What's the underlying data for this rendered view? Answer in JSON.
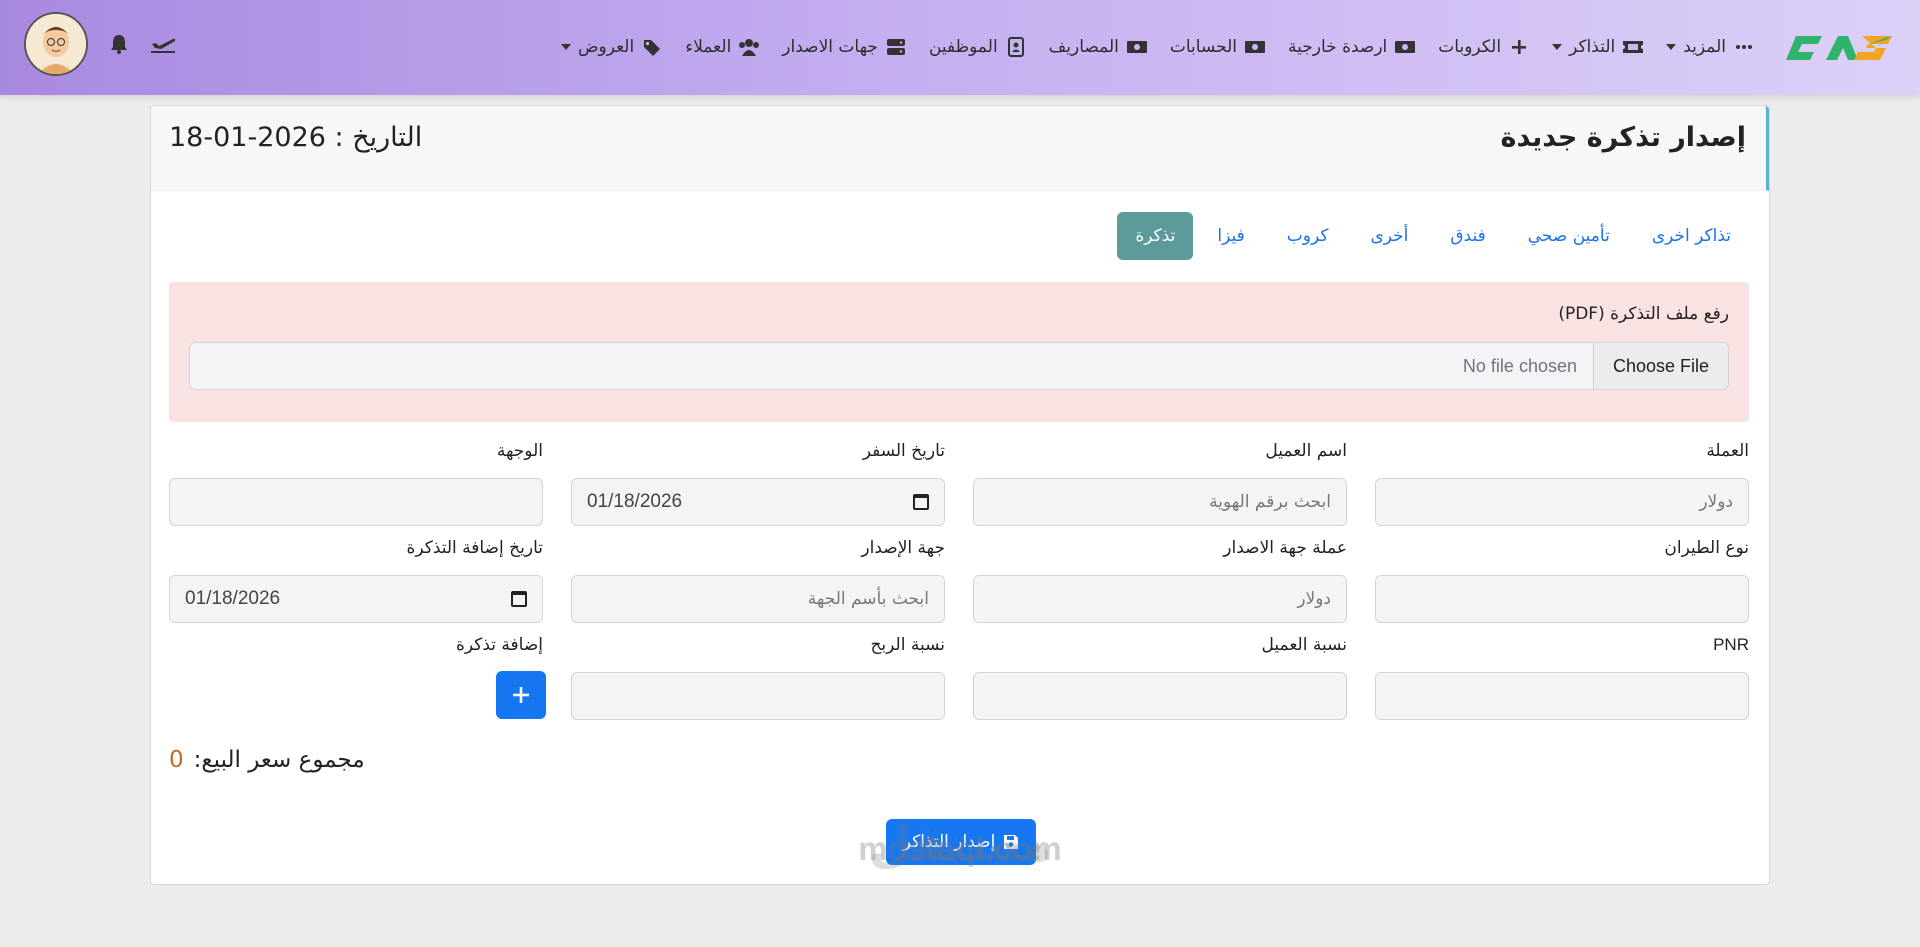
{
  "nav": {
    "items": [
      {
        "label": "العروض",
        "icon": "tags-icon",
        "dropdown": true
      },
      {
        "label": "العملاء",
        "icon": "users-icon",
        "dropdown": false
      },
      {
        "label": "جهات الاصدار",
        "icon": "server-icon",
        "dropdown": false
      },
      {
        "label": "الموظفين",
        "icon": "id-card-icon",
        "dropdown": false
      },
      {
        "label": "المصاريف",
        "icon": "money-icon",
        "dropdown": false
      },
      {
        "label": "الحسابات",
        "icon": "money-icon",
        "dropdown": false
      },
      {
        "label": "ارصدة خارجية",
        "icon": "money-icon",
        "dropdown": false
      },
      {
        "label": "الكروبات",
        "icon": "plus-icon",
        "dropdown": false
      },
      {
        "label": "التذاكر",
        "icon": "ticket-icon",
        "dropdown": true
      },
      {
        "label": "المزيد",
        "icon": "ellipsis-icon",
        "dropdown": true
      }
    ]
  },
  "card": {
    "title": "إصدار تذكرة جديدة",
    "date": "التاريخ : 2026-01-18"
  },
  "tabs": [
    {
      "label": "تذكرة",
      "active": true
    },
    {
      "label": "فيزا",
      "active": false
    },
    {
      "label": "كروب",
      "active": false
    },
    {
      "label": "أخرى",
      "active": false
    },
    {
      "label": "فندق",
      "active": false
    },
    {
      "label": "تأمين صحي",
      "active": false
    },
    {
      "label": "تذاكر اخرى",
      "active": false
    }
  ],
  "upload": {
    "label": "رفع ملف التذكرة (PDF)",
    "button": "Choose File",
    "status": "No file chosen"
  },
  "fields": {
    "currency": {
      "label": "العملة",
      "value": "دولار"
    },
    "client_name": {
      "label": "اسم العميل",
      "value": "ابحث برقم الهوية"
    },
    "travel_date": {
      "label": "تاريخ السفر",
      "value": "01/18/2026"
    },
    "destination": {
      "label": "الوجهة",
      "value": ""
    },
    "airline": {
      "label": "نوع الطيران",
      "value": ""
    },
    "issuer_currency": {
      "label": "عملة جهة الاصدار",
      "value": "دولار"
    },
    "issuer": {
      "label": "جهة الإصدار",
      "value": "ابحث بأسم الجهة"
    },
    "ticket_add_date": {
      "label": "تاريخ إضافة التذكرة",
      "value": "01/18/2026"
    },
    "pnr": {
      "label": "PNR",
      "value": ""
    },
    "client_ratio": {
      "label": "نسبة العميل",
      "value": ""
    },
    "profit_ratio": {
      "label": "نسبة الربح",
      "value": ""
    },
    "add_ticket": {
      "label": "إضافة تذكرة"
    }
  },
  "total": {
    "label": "مجموع سعر البيع:",
    "value": "0"
  },
  "issue_button": "إصدار التذاكر",
  "watermark": {
    "text": "mostaql.com",
    "arabic": "مستقل"
  }
}
